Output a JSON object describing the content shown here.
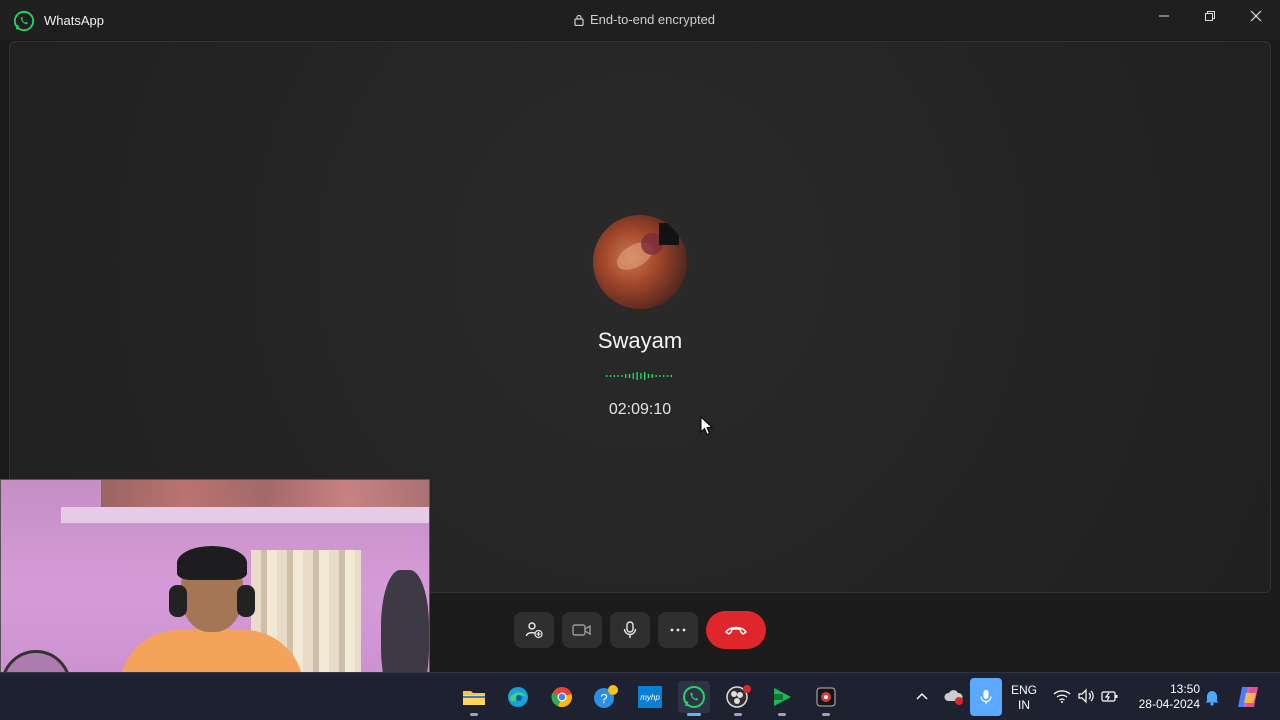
{
  "window": {
    "app_name": "WhatsApp",
    "encryption_label": "End-to-end encrypted",
    "controls": [
      "minimize-icon",
      "restore-icon",
      "close-icon"
    ]
  },
  "call": {
    "caller_name": "Swayam",
    "duration": "02:09:10",
    "status_indicator": "audio-wave",
    "accent_color": "#25d366",
    "end_call_color": "#e0262d",
    "controls": [
      {
        "name": "add-participant-button",
        "icon": "add-person-icon"
      },
      {
        "name": "video-button",
        "icon": "video-camera-icon"
      },
      {
        "name": "mute-button",
        "icon": "microphone-icon"
      },
      {
        "name": "more-options-button",
        "icon": "ellipsis-icon"
      },
      {
        "name": "end-call-button",
        "icon": "hang-up-icon"
      }
    ]
  },
  "taskbar": {
    "apps": [
      "file-explorer-icon",
      "edge-icon",
      "chrome-icon",
      "help-icon",
      "myhp-icon",
      "whatsapp-icon",
      "obs-icon",
      "video-editor-icon",
      "app-icon"
    ],
    "myhp_label": "myhp",
    "language_line1": "ENG",
    "language_line2": "IN",
    "time": "13:50",
    "date": "28-04-2024"
  }
}
